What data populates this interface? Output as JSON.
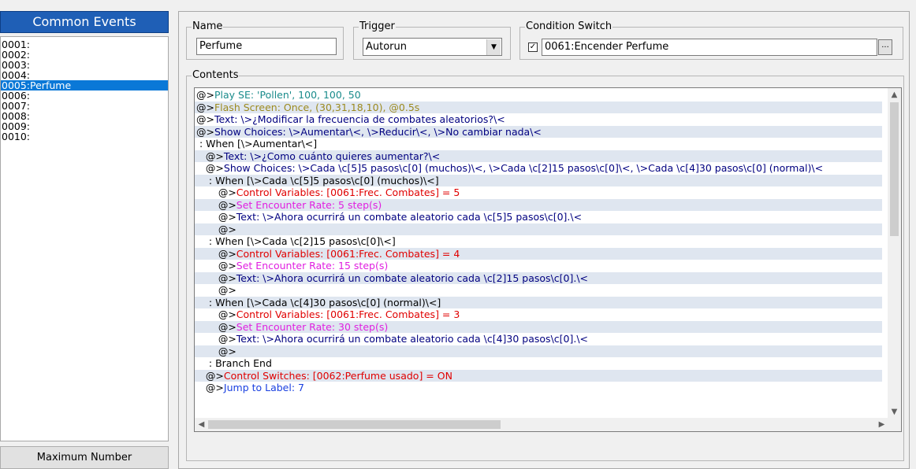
{
  "common_events": {
    "header": "Common Events",
    "items": [
      "0001:",
      "0002:",
      "0003:",
      "0004:",
      "0005:Perfume",
      "0006:",
      "0007:",
      "0008:",
      "0009:",
      "0010:"
    ],
    "selected_index": 4,
    "max_button": "Maximum Number"
  },
  "name": {
    "label": "Name",
    "value": "Perfume"
  },
  "trigger": {
    "label": "Trigger",
    "value": "Autorun"
  },
  "condition_switch": {
    "label": "Condition Switch",
    "checked": true,
    "value": "0061:Encender Perfume",
    "dots": "..."
  },
  "contents": {
    "label": "Contents",
    "commands": [
      {
        "pre": "@>",
        "text": "Play SE: 'Pollen', 100, 100, 50",
        "kind": "play"
      },
      {
        "pre": "@>",
        "text": "Flash Screen: Once, (30,31,18,10), @0.5s",
        "kind": "flash"
      },
      {
        "pre": "@>",
        "text": "Text: \\>¿Modificar la frecuencia de combates aleatorios?\\<",
        "kind": "text"
      },
      {
        "pre": "@>",
        "text": "Show Choices: \\>Aumentar\\<, \\>Reducir\\<, \\>No cambiar nada\\<",
        "kind": "text"
      },
      {
        "pre": " : ",
        "text": "When [\\>Aumentar\\<]",
        "kind": "when"
      },
      {
        "pre": "   @>",
        "text": "Text: \\>¿Como cuánto quieres aumentar?\\<",
        "kind": "text"
      },
      {
        "pre": "   @>",
        "text": "Show Choices: \\>Cada \\c[5]5 pasos\\c[0] (muchos)\\<, \\>Cada \\c[2]15 pasos\\c[0]\\<, \\>Cada \\c[4]30 pasos\\c[0] (normal)\\<",
        "kind": "text"
      },
      {
        "pre": "    : ",
        "text": "When [\\>Cada \\c[5]5 pasos\\c[0] (muchos)\\<]",
        "kind": "when"
      },
      {
        "pre": "       @>",
        "text": "Control Variables: [0061:Frec. Combates] = 5",
        "kind": "ctrl"
      },
      {
        "pre": "       @>",
        "text": "Set Encounter Rate: 5 step(s)",
        "kind": "enc"
      },
      {
        "pre": "       @>",
        "text": "Text: \\>Ahora ocurrirá un combate aleatorio cada \\c[5]5 pasos\\c[0].\\<",
        "kind": "text"
      },
      {
        "pre": "       @>",
        "text": "",
        "kind": "text"
      },
      {
        "pre": "    : ",
        "text": "When [\\>Cada \\c[2]15 pasos\\c[0]\\<]",
        "kind": "when"
      },
      {
        "pre": "       @>",
        "text": "Control Variables: [0061:Frec. Combates] = 4",
        "kind": "ctrl"
      },
      {
        "pre": "       @>",
        "text": "Set Encounter Rate: 15 step(s)",
        "kind": "enc"
      },
      {
        "pre": "       @>",
        "text": "Text: \\>Ahora ocurrirá un combate aleatorio cada \\c[2]15 pasos\\c[0].\\<",
        "kind": "text"
      },
      {
        "pre": "       @>",
        "text": "",
        "kind": "text"
      },
      {
        "pre": "    : ",
        "text": "When [\\>Cada \\c[4]30 pasos\\c[0] (normal)\\<]",
        "kind": "when"
      },
      {
        "pre": "       @>",
        "text": "Control Variables: [0061:Frec. Combates] = 3",
        "kind": "ctrl"
      },
      {
        "pre": "       @>",
        "text": "Set Encounter Rate: 30 step(s)",
        "kind": "enc"
      },
      {
        "pre": "       @>",
        "text": "Text: \\>Ahora ocurrirá un combate aleatorio cada \\c[4]30 pasos\\c[0].\\<",
        "kind": "text"
      },
      {
        "pre": "       @>",
        "text": "",
        "kind": "text"
      },
      {
        "pre": "    : ",
        "text": "Branch End",
        "kind": "when"
      },
      {
        "pre": "   @>",
        "text": "Control Switches: [0062:Perfume usado] = ON",
        "kind": "ctrl"
      },
      {
        "pre": "   @>",
        "text": "Jump to Label: 7",
        "kind": "jump"
      }
    ]
  },
  "colors": {
    "list_header_bg": "#1f5fb6",
    "selection": "#0a78d7",
    "play_se": "#1a8b8b",
    "flash": "#9c8a1f",
    "text_cmd": "#000080",
    "control": "#e00000",
    "encounter": "#e020e0",
    "jump": "#1a40e0"
  }
}
